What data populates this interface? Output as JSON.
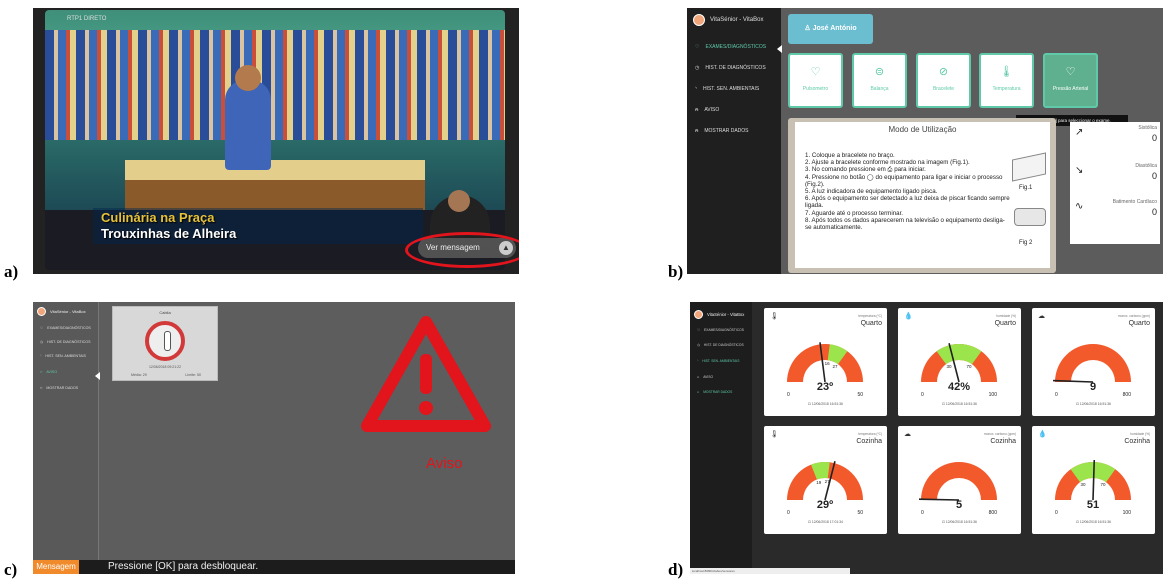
{
  "labels": {
    "a": "a)",
    "b": "b)",
    "c": "c)",
    "d": "d)"
  },
  "colors": {
    "accent": "#5fc9a9",
    "alert_red": "#e2141c",
    "gauge_red": "#f25a2c",
    "gauge_green": "#9ce44c",
    "message_orange": "#f08a2a"
  },
  "panel_a": {
    "channel_logo": "RTP1 DIRETO",
    "caption_line1": "Culinária na Praça",
    "caption_line2": "Trouxinhas de Alheira",
    "message_button": "Ver mensagem",
    "message_icon": "up-arrow-icon"
  },
  "panel_b": {
    "brand": "VitaSénior - VitaBox",
    "nav": [
      "EXAMES/DIAGNÓSTICOS",
      "HIST. DE DIAGNÓSTICOS",
      "HIST. SEN. AMBIENTAIS",
      "AVISO",
      "MOSTRAR DADOS"
    ],
    "user": "José António",
    "cards": [
      "Pulsometro",
      "Balança",
      "Bracelete",
      "Temperatura",
      "Pressão Arterial"
    ],
    "tooltip": "Pressione em [OK] para seleccionar o exame.",
    "guide_title": "Modo de Utilização",
    "steps": [
      "1. Coloque a bracelete no braço.",
      "2. Ajuste a bracelete conforme mostrado na imagem (Fig.1).",
      "3. No comando pressione em ⎙ para iniciar.",
      "4. Pressione no botão ◯ do equipamento para ligar e iniciar o processo (Fig.2).",
      "5. A luz indicadora de equipamento ligado pisca.",
      "6. Após o equipamento ser detectado a luz deixa de piscar ficando sempre ligada.",
      "7. Aguarde até o processo terminar.",
      "8. Após todos os dados aparecerem na televisão o equipamento desliga-se automaticamente."
    ],
    "fig1": "Fig.1",
    "fig2": "Fig 2",
    "vitals": [
      {
        "label": "Sistólica",
        "value": "0"
      },
      {
        "label": "Diastólica",
        "value": "0"
      },
      {
        "label": "Batimento Cardíaco",
        "value": "0"
      }
    ]
  },
  "panel_c": {
    "brand": "VitaSénior - VitaBox",
    "nav": [
      "EXAMES/DIAGNÓSTICOS",
      "HIST. DE DIAGNÓSTICOS",
      "HIST. SEN. AMBIENTAIS",
      "AVISO",
      "MOSTRAR DADOS"
    ],
    "alert_title": "Cabila",
    "alert_datetime": "12/06/2018 09:21:22",
    "alert_media": "Média: 29",
    "alert_limite": "Limite: 50",
    "aviso": "Aviso",
    "footer_button": "Mensagem",
    "footer_text": "Pressione [OK] para desbloquear."
  },
  "panel_d": {
    "brand": "VitaSénior - VitaBox",
    "nav": [
      "EXAMES/DIAGNÓSTICOS",
      "HIST. DE DIAGNÓSTICOS",
      "HIST. SEN. AMBIENTAIS",
      "AVISO",
      "MOSTRAR DADOS"
    ],
    "gauges": [
      {
        "sensor": "temperatura (ºC)",
        "room": "Quarto",
        "value": 23,
        "display": "23º",
        "min": 0,
        "max": 50,
        "green": [
          27,
          35
        ],
        "marker_labels": [
          "16",
          "27"
        ],
        "icon": "thermometer-icon",
        "ts": "12/06/2018 16:51:36"
      },
      {
        "sensor": "humidade (%)",
        "room": "Quarto",
        "value": 42,
        "display": "42%",
        "min": 0,
        "max": 100,
        "green": [
          30,
          70
        ],
        "marker_labels": [
          "30",
          "70"
        ],
        "icon": "droplet-icon",
        "ts": "12/06/2018 16:51:36"
      },
      {
        "sensor": "monox. carbono (ppm)",
        "room": "Quarto",
        "value": 9,
        "display": "9",
        "min": 0,
        "max": 800,
        "green": [
          0,
          0
        ],
        "marker_labels": [],
        "icon": "cloud-icon",
        "ts": "12/06/2018 16:51:36"
      },
      {
        "sensor": "temperatura (ºC)",
        "room": "Cozinha",
        "value": 29,
        "display": "29º",
        "min": 0,
        "max": 50,
        "green": [
          19,
          27
        ],
        "marker_labels": [
          "19",
          "27"
        ],
        "icon": "thermometer-icon",
        "ts": "12/06/2018 17:01:34"
      },
      {
        "sensor": "monox. carbono (ppm)",
        "room": "Cozinha",
        "value": 5,
        "display": "5",
        "min": 0,
        "max": 800,
        "green": [
          0,
          0
        ],
        "marker_labels": [],
        "icon": "cloud-icon",
        "ts": "12/06/2018 16:51:36"
      },
      {
        "sensor": "humidade (%)",
        "room": "Cozinha",
        "value": 51,
        "display": "51",
        "min": 0,
        "max": 100,
        "green": [
          30,
          70
        ],
        "marker_labels": [
          "30",
          "70"
        ],
        "icon": "droplet-icon",
        "ts": "12/06/2018 16:51:36"
      }
    ],
    "status_url": "localhost:8080/vitabox/sensores"
  }
}
